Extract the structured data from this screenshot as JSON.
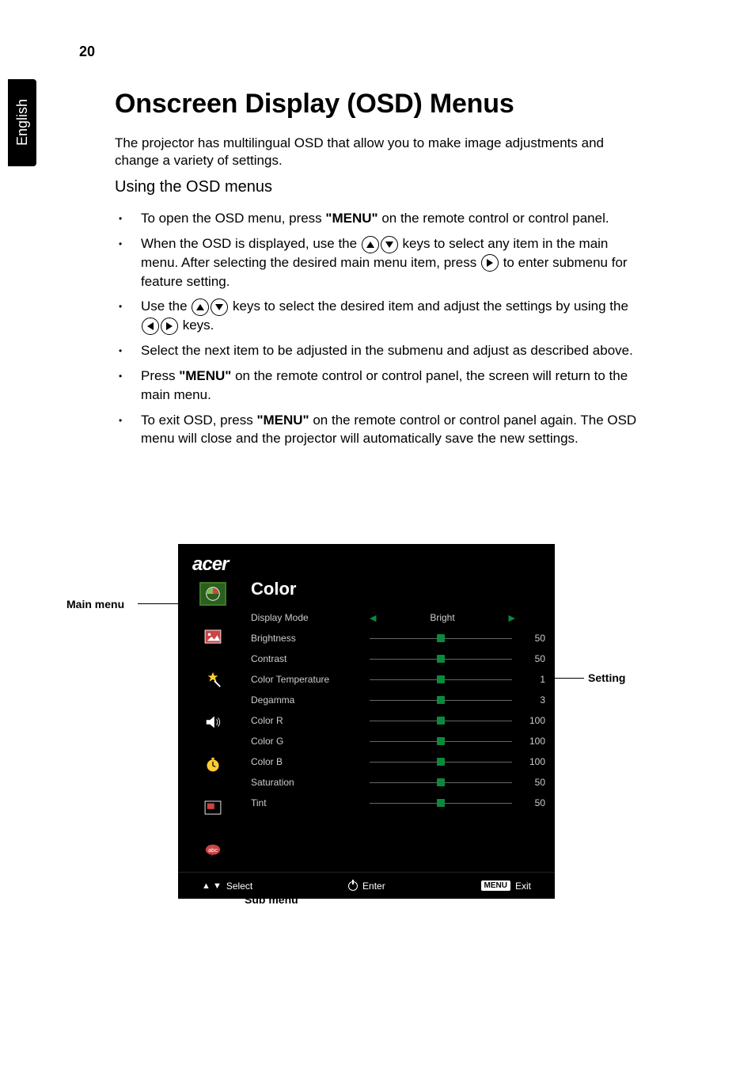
{
  "page": {
    "number": "20",
    "language_tab": "English",
    "heading": "Onscreen Display (OSD) Menus",
    "intro": "The projector has multilingual OSD that allow you to make image adjustments and change a variety of settings.",
    "subheading": "Using the OSD menus",
    "bullets": {
      "b1_a": "To open the OSD menu, press ",
      "b1_menu": "\"MENU\"",
      "b1_b": " on the remote control or control panel.",
      "b2_a": "When the OSD is displayed, use the ",
      "b2_b": " keys to select any item in the main menu. After selecting the desired main menu item, press ",
      "b2_c": " to enter submenu for feature setting.",
      "b3_a": "Use the ",
      "b3_b": " keys to select the desired item and adjust the settings by using the ",
      "b3_c": " keys.",
      "b4": "Select the next item to be adjusted in the submenu and adjust as described above.",
      "b5_a": "Press ",
      "b5_menu": "\"MENU\"",
      "b5_b": " on the remote control or control panel, the screen will return to the main menu.",
      "b6_a": "To exit OSD, press ",
      "b6_menu": "\"MENU\"",
      "b6_b": " on the remote control or control panel again. The OSD menu will close and the projector will automatically save the new settings."
    }
  },
  "callouts": {
    "main_menu": "Main menu",
    "sub_menu": "Sub menu",
    "setting": "Setting"
  },
  "osd": {
    "brand": "acer",
    "title": "Color",
    "sidebar_icons": [
      "color-icon",
      "image-icon",
      "management-icon",
      "audio-icon",
      "timer-icon",
      "pip-icon",
      "language-icon"
    ],
    "rows": [
      {
        "label": "Display Mode",
        "type": "enum",
        "value": "Bright"
      },
      {
        "label": "Brightness",
        "type": "slider",
        "value": "50",
        "pos": 50
      },
      {
        "label": "Contrast",
        "type": "slider",
        "value": "50",
        "pos": 50
      },
      {
        "label": "Color Temperature",
        "type": "slider",
        "value": "1",
        "pos": 50
      },
      {
        "label": "Degamma",
        "type": "slider",
        "value": "3",
        "pos": 50
      },
      {
        "label": "Color R",
        "type": "slider",
        "value": "100",
        "pos": 50
      },
      {
        "label": "Color G",
        "type": "slider",
        "value": "100",
        "pos": 50
      },
      {
        "label": "Color B",
        "type": "slider",
        "value": "100",
        "pos": 50
      },
      {
        "label": "Saturation",
        "type": "slider",
        "value": "50",
        "pos": 50
      },
      {
        "label": "Tint",
        "type": "slider",
        "value": "50",
        "pos": 50
      }
    ],
    "footer": {
      "select": "Select",
      "enter": "Enter",
      "exit": "Exit",
      "menu_btn": "MENU"
    }
  }
}
